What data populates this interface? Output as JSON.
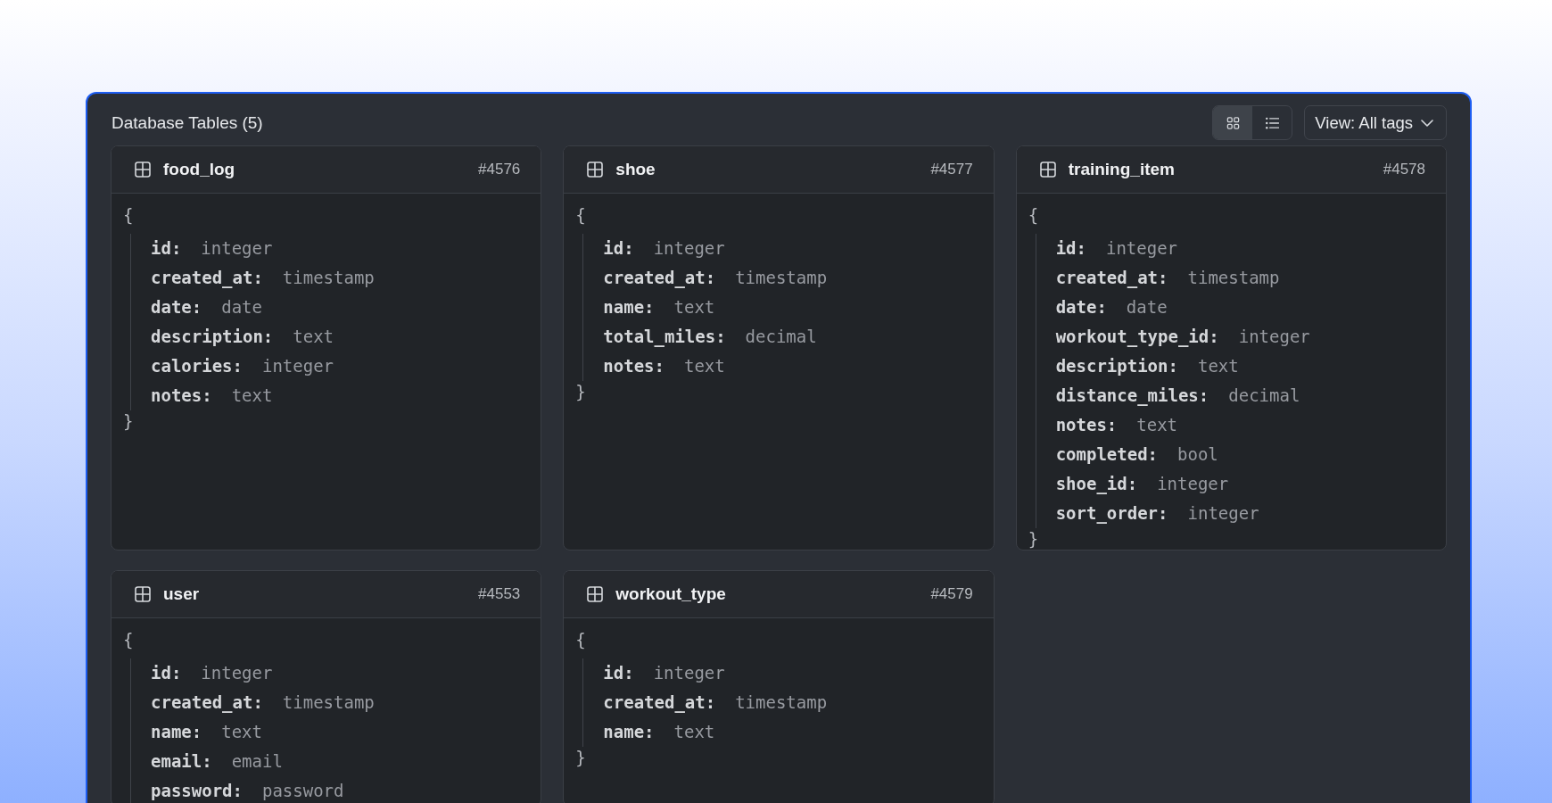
{
  "panel": {
    "title": "Database Tables (5)",
    "view_toggle": [
      {
        "kind": "grid",
        "selected": true
      },
      {
        "kind": "list",
        "selected": false
      }
    ],
    "view_dropdown": {
      "label": "View: All tags"
    }
  },
  "tables": [
    {
      "name": "food_log",
      "id": "#4576",
      "open_brace": "{",
      "close_brace": "}",
      "fields": [
        {
          "name": "id:",
          "type": "integer"
        },
        {
          "name": "created_at:",
          "type": "timestamp"
        },
        {
          "name": "date:",
          "type": "date"
        },
        {
          "name": "description:",
          "type": "text"
        },
        {
          "name": "calories:",
          "type": "integer"
        },
        {
          "name": "notes:",
          "type": "text"
        }
      ]
    },
    {
      "name": "shoe",
      "id": "#4577",
      "open_brace": "{",
      "close_brace": "}",
      "fields": [
        {
          "name": "id:",
          "type": "integer"
        },
        {
          "name": "created_at:",
          "type": "timestamp"
        },
        {
          "name": "name:",
          "type": "text"
        },
        {
          "name": "total_miles:",
          "type": "decimal"
        },
        {
          "name": "notes:",
          "type": "text"
        }
      ]
    },
    {
      "name": "training_item",
      "id": "#4578",
      "open_brace": "{",
      "close_brace": "}",
      "fields": [
        {
          "name": "id:",
          "type": "integer"
        },
        {
          "name": "created_at:",
          "type": "timestamp"
        },
        {
          "name": "date:",
          "type": "date"
        },
        {
          "name": "workout_type_id:",
          "type": "integer"
        },
        {
          "name": "description:",
          "type": "text"
        },
        {
          "name": "distance_miles:",
          "type": "decimal"
        },
        {
          "name": "notes:",
          "type": "text"
        },
        {
          "name": "completed:",
          "type": "bool"
        },
        {
          "name": "shoe_id:",
          "type": "integer"
        },
        {
          "name": "sort_order:",
          "type": "integer"
        }
      ]
    },
    {
      "name": "user",
      "id": "#4553",
      "open_brace": "{",
      "fields": [
        {
          "name": "id:",
          "type": "integer"
        },
        {
          "name": "created_at:",
          "type": "timestamp"
        },
        {
          "name": "name:",
          "type": "text"
        },
        {
          "name": "email:",
          "type": "email"
        },
        {
          "name": "password:",
          "type": "password"
        }
      ]
    },
    {
      "name": "workout_type",
      "id": "#4579",
      "open_brace": "{",
      "close_brace": "}",
      "fields": [
        {
          "name": "id:",
          "type": "integer"
        },
        {
          "name": "created_at:",
          "type": "timestamp"
        },
        {
          "name": "name:",
          "type": "text"
        }
      ]
    }
  ]
}
